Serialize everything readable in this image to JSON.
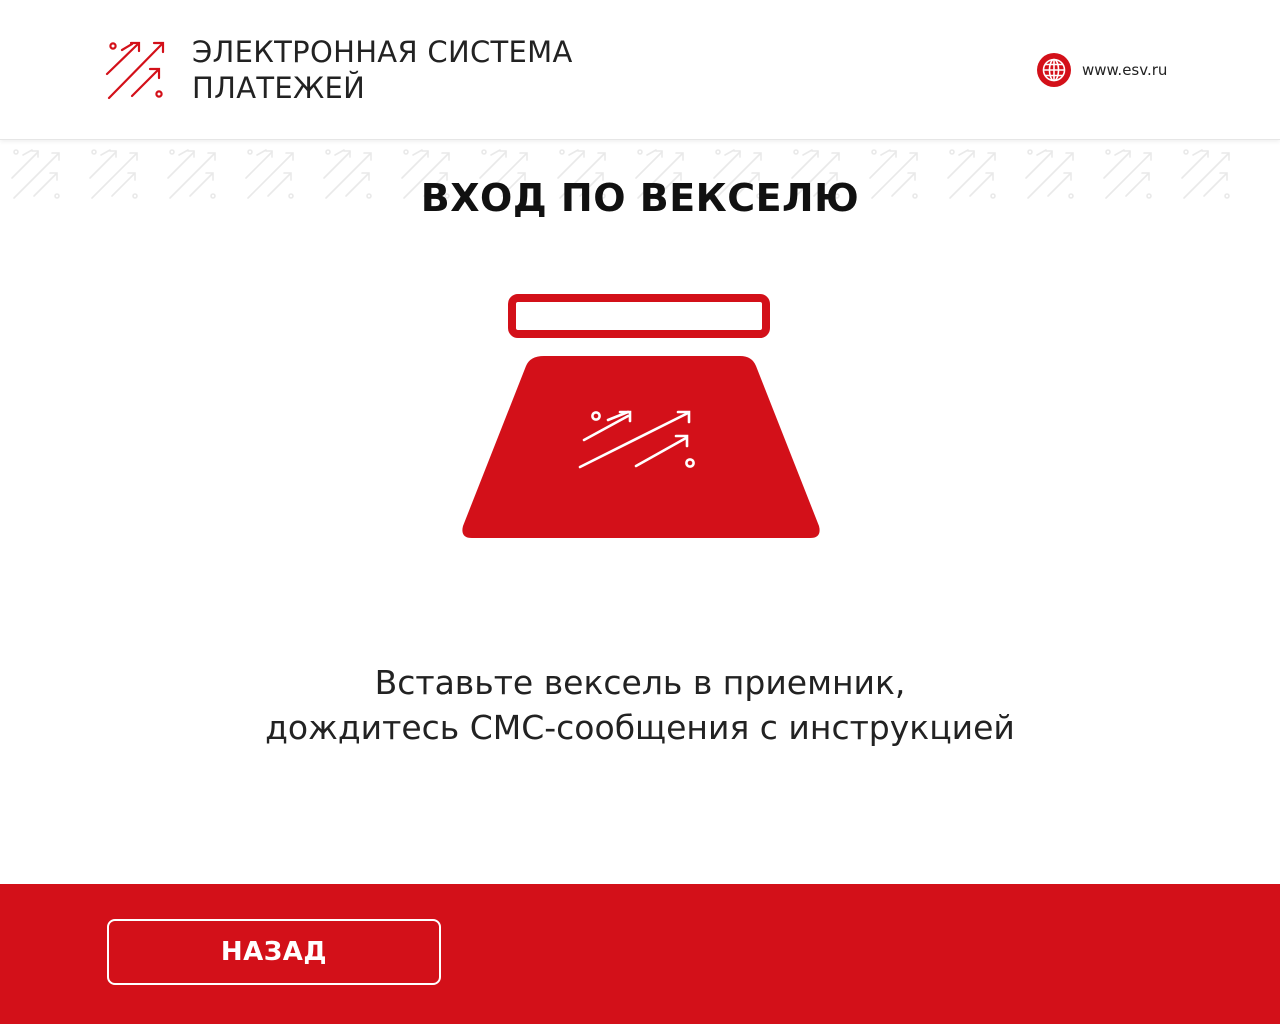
{
  "header": {
    "brand_line1": "ЭЛЕКТРОННАЯ СИСТЕМА",
    "brand_line2": "ПЛАТЕЖЕЙ",
    "site_url": "www.esv.ru"
  },
  "main": {
    "title": "ВХОД ПО ВЕКСЕЛЮ",
    "instruction_line1": "Вставьте вексель в приемник,",
    "instruction_line2": "дождитесь СМС-сообщения с инструкцией"
  },
  "footer": {
    "back_label": "НАЗАД"
  },
  "icons": {
    "logo": "growth-arrows-logo-icon",
    "globe": "globe-icon",
    "acceptor": "bill-acceptor-icon"
  },
  "colors": {
    "brand_red": "#d31019",
    "text": "#222222",
    "background": "#ffffff"
  }
}
